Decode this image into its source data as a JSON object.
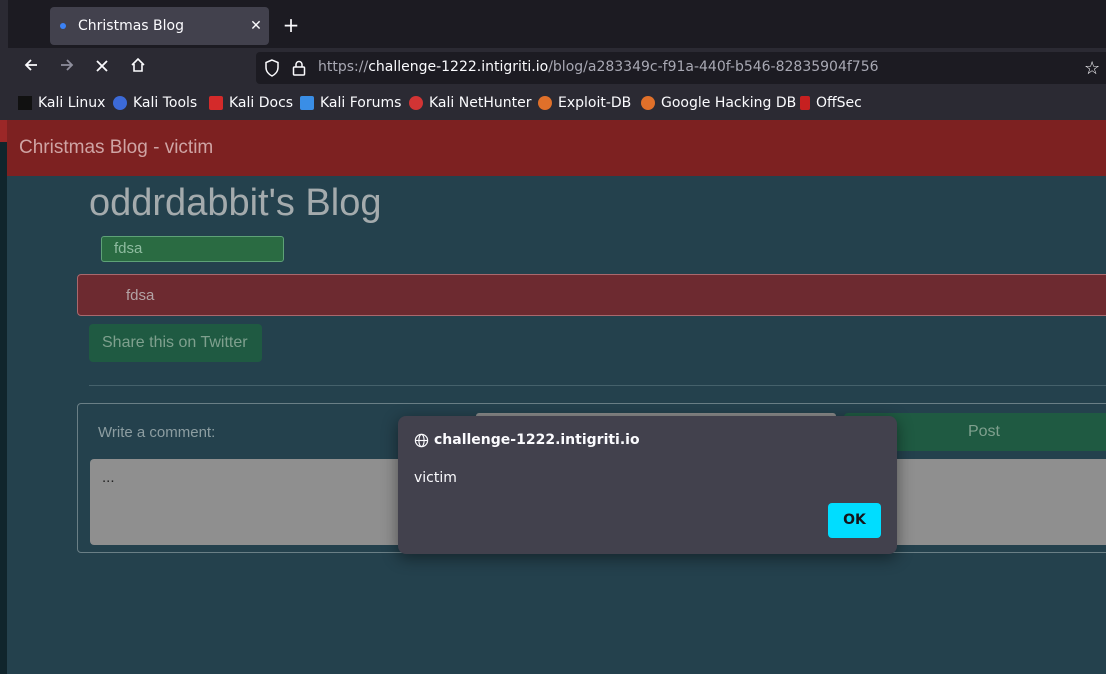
{
  "browser": {
    "tab": {
      "title": "Christmas Blog",
      "close_glyph": "✕"
    },
    "new_tab_glyph": "+",
    "url_scheme": "https://",
    "url_domain": "challenge-1222.intigriti.io",
    "url_path": "/blog/a283349c-f91a-440f-b546-82835904f756",
    "bookmarks": [
      {
        "label": "Kali Linux",
        "icon": "kali-dragon-icon"
      },
      {
        "label": "Kali Tools",
        "icon": "kali-tools-icon"
      },
      {
        "label": "Kali Docs",
        "icon": "kali-docs-icon"
      },
      {
        "label": "Kali Forums",
        "icon": "kali-forums-icon"
      },
      {
        "label": "Kali NetHunter",
        "icon": "nethunter-icon"
      },
      {
        "label": "Exploit-DB",
        "icon": "exploit-db-icon"
      },
      {
        "label": "Google Hacking DB",
        "icon": "ghdb-icon"
      },
      {
        "label": "OffSec",
        "icon": "offsec-icon"
      }
    ]
  },
  "site": {
    "header_title": "Christmas Blog - victim",
    "blog_heading": "oddrdabbit's Blog",
    "tag": "fdsa",
    "post_body": "fdsa",
    "share_label": "Share this on Twitter",
    "comment_label": "Write a comment:",
    "post_button": "Post",
    "comment_value": "..."
  },
  "dialog": {
    "origin": "challenge-1222.intigriti.io",
    "message": "victim",
    "ok_label": "OK"
  },
  "colors": {
    "accent": "#00ddff",
    "header": "#7d2121",
    "page_bg": "#24414d"
  }
}
